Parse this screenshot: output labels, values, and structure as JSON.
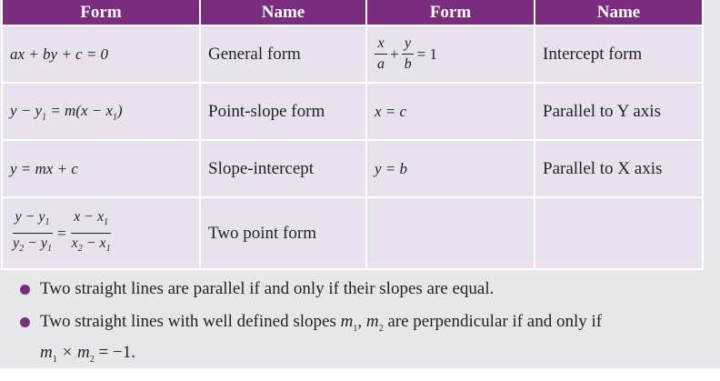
{
  "table": {
    "headers": [
      "Form",
      "Name",
      "Form",
      "Name"
    ],
    "rows": [
      {
        "form1": "ax + by + c = 0",
        "name1": "General form",
        "form2": {
          "num1": "x",
          "den1": "a",
          "op": "+",
          "num2": "y",
          "den2": "b",
          "rhs": "= 1"
        },
        "name2": "Intercept form"
      },
      {
        "form1": {
          "a": "y − y",
          "a_sub": "1",
          "b": " = m(x − x",
          "b_sub": "1",
          "c": ")"
        },
        "name1": "Point-slope form",
        "form2": "x = c",
        "name2": "Parallel to Y axis"
      },
      {
        "form1": "y = mx + c",
        "name1": "Slope-intercept",
        "form2": "y = b",
        "name2": "Parallel to X axis"
      },
      {
        "form1": {
          "ln": "y − y",
          "ln_sub": "1",
          "ld": "y",
          "ld_sub1": "2",
          "ld_mid": " − y",
          "ld_sub2": "1",
          "eq": "=",
          "rn": "x − x",
          "rn_sub": "1",
          "rd": "x",
          "rd_sub1": "2",
          "rd_mid": " − x",
          "rd_sub2": "1"
        },
        "name1": "Two point form",
        "form2": "",
        "name2": ""
      }
    ]
  },
  "bullets": [
    {
      "text": "Two straight lines are parallel if and only if their slopes are equal."
    },
    {
      "text_a": "Two straight lines with well defined slopes ",
      "m1": "m",
      "m1_sub": "1",
      "comma": ", ",
      "m2": "m",
      "m2_sub": "2",
      "text_b": " are perpendicular if and only if",
      "line2_a": "m",
      "line2_a_sub": "1",
      "line2_b": " × m",
      "line2_b_sub": "2",
      "line2_c": " = −1."
    }
  ],
  "colors": {
    "header": "#7b2d7d",
    "cell": "#e9e1ed",
    "background": "#e7e7e9"
  }
}
